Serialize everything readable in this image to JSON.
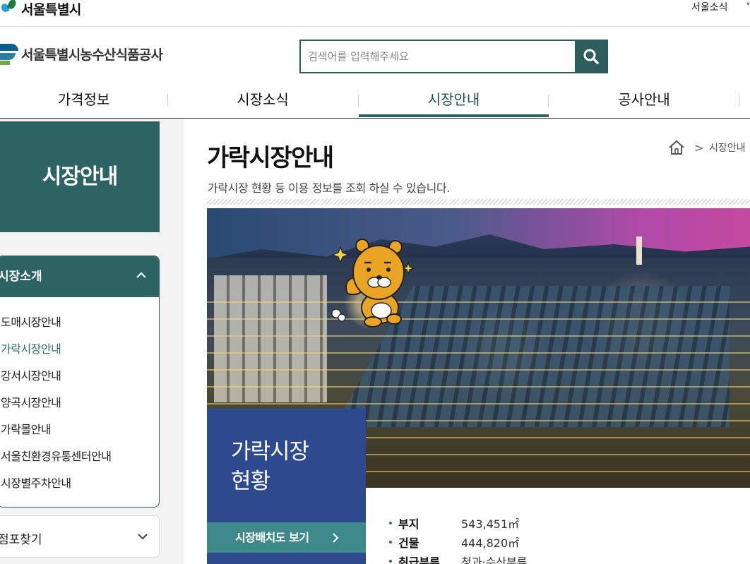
{
  "topbar": {
    "seoul_logo_text": "서울특별시",
    "util_link": "서울소식",
    "util_more": "˅"
  },
  "header": {
    "org_name": "서울특별시농수산식품공사",
    "search_placeholder": "검색어를 입력해주세요"
  },
  "gnb": {
    "items": [
      {
        "label": "가격정보"
      },
      {
        "label": "시장소식"
      },
      {
        "label": "시장안내"
      },
      {
        "label": "공사안내"
      }
    ],
    "active": "시장안내"
  },
  "lnb": {
    "title": "시장안내",
    "group_label": "시장소개",
    "sub_items": [
      {
        "label": "도매시장안내"
      },
      {
        "label": "가락시장안내"
      },
      {
        "label": "강서시장안내"
      },
      {
        "label": "양곡시장안내"
      },
      {
        "label": "가락몰안내"
      },
      {
        "label": "서울친환경유통센터안내"
      },
      {
        "label": "시장별주차안내"
      }
    ],
    "active_sub": "가락시장안내",
    "group2_label": "점포찾기"
  },
  "content": {
    "title": "가락시장안내",
    "description": "가락시장 현황 등 이용 정보를 조회 하실 수 있습니다.",
    "breadcrumb": "시장안내",
    "card_title_line1": "가락시장",
    "card_title_line2": "현황",
    "card_button": "시장배치도 보기",
    "stats": [
      {
        "label": "부지",
        "value": "543,451㎡"
      },
      {
        "label": "건물",
        "value": "444,820㎡"
      },
      {
        "label": "취급부류",
        "value": "청과·수산부류"
      }
    ]
  },
  "colors": {
    "primary_teal": "#2d6463",
    "card_blue": "#2e4a8e",
    "button_teal": "#3e8a8a"
  }
}
